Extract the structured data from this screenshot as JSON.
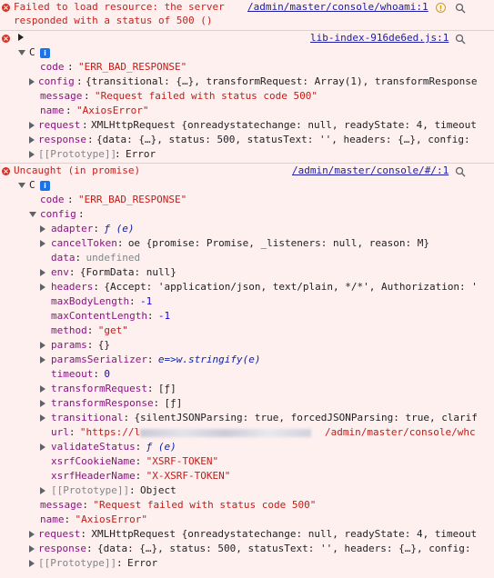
{
  "entries": [
    {
      "message_line1": "Failed to load resource: the server",
      "message_line2": "responded with a status of 500 ()",
      "source": "/admin/master/console/whoami:1"
    },
    {
      "source": "lib-index-916de6ed.js:1",
      "object_label": "C",
      "info_badge": "i",
      "props": [
        {
          "key": "code",
          "value": "\"ERR_BAD_RESPONSE\""
        },
        {
          "key": "config",
          "value": "{transitional: {…}, transformRequest: Array(1), transformResponse"
        },
        {
          "key": "message",
          "value": "\"Request failed with status code 500\""
        },
        {
          "key": "name",
          "value": "\"AxiosError\""
        },
        {
          "key": "request",
          "value": "XMLHttpRequest {onreadystatechange: null, readyState: 4, timeout"
        },
        {
          "key": "response",
          "value": "{data: {…}, status: 500, statusText: '', headers: {…}, config:"
        },
        {
          "key": "[[Prototype]]",
          "value": "Error"
        }
      ]
    },
    {
      "message": "Uncaught (in promise)",
      "source": "/admin/master/console/#/:1",
      "object_label": "C",
      "info_badge": "i",
      "code": {
        "key": "code",
        "value": "\"ERR_BAD_RESPONSE\""
      },
      "config_key": "config",
      "config_props": [
        {
          "key": "adapter",
          "value": "ƒ (e)"
        },
        {
          "key": "cancelToken",
          "value": "oe {promise: Promise, _listeners: null, reason: M}"
        },
        {
          "key": "data",
          "value": "undefined"
        },
        {
          "key": "env",
          "value": "{FormData: null}"
        },
        {
          "key": "headers",
          "value": "{Accept: 'application/json, text/plain, */*', Authorization: '"
        },
        {
          "key": "maxBodyLength",
          "value": "-1"
        },
        {
          "key": "maxContentLength",
          "value": "-1"
        },
        {
          "key": "method",
          "value": "\"get\""
        },
        {
          "key": "params",
          "value": "{}"
        },
        {
          "key": "paramsSerializer",
          "value": "e=>w.stringify(e)"
        },
        {
          "key": "timeout",
          "value": "0"
        },
        {
          "key": "transformRequest",
          "value": "[ƒ]"
        },
        {
          "key": "transformResponse",
          "value": "[ƒ]"
        },
        {
          "key": "transitional",
          "value": "{silentJSONParsing: true, forcedJSONParsing: true, clarif"
        },
        {
          "key": "url",
          "value_prefix": "\"https://l",
          "value_suffix": "/admin/master/console/whc"
        },
        {
          "key": "validateStatus",
          "value": "ƒ (e)"
        },
        {
          "key": "xsrfCookieName",
          "value": "\"XSRF-TOKEN\""
        },
        {
          "key": "xsrfHeaderName",
          "value": "\"X-XSRF-TOKEN\""
        },
        {
          "key": "[[Prototype]]",
          "value": "Object"
        }
      ],
      "tail_props": [
        {
          "key": "message",
          "value": "\"Request failed with status code 500\""
        },
        {
          "key": "name",
          "value": "\"AxiosError\""
        },
        {
          "key": "request",
          "value": "XMLHttpRequest {onreadystatechange: null, readyState: 4, timeout"
        },
        {
          "key": "response",
          "value": "{data: {…}, status: 500, statusText: '', headers: {…}, config:"
        },
        {
          "key": "[[Prototype]]",
          "value": "Error"
        }
      ]
    }
  ],
  "icons": {
    "error": "error-icon",
    "warning": "warning-badge-icon",
    "search": "magnifier-icon"
  },
  "colors": {
    "error_text": "#c5221f",
    "background": "#fff0f0",
    "link": "#1a1aa6",
    "key": "#881280",
    "string": "#c41a16",
    "number": "#1c00cf"
  }
}
